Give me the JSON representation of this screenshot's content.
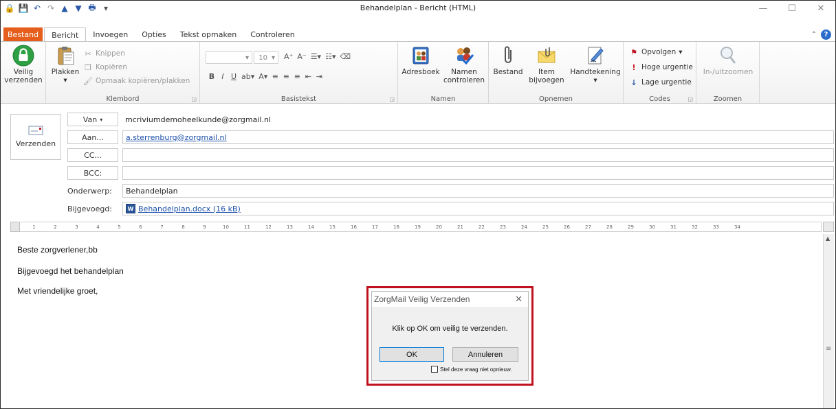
{
  "window": {
    "title": "Behandelplan - Bericht (HTML)"
  },
  "tabs": [
    {
      "label": "Bestand"
    },
    {
      "label": "Bericht"
    },
    {
      "label": "Invoegen"
    },
    {
      "label": "Opties"
    },
    {
      "label": "Tekst opmaken"
    },
    {
      "label": "Controleren"
    }
  ],
  "ribbon": {
    "secure_send": {
      "line1": "Veilig",
      "line2": "verzenden"
    },
    "clipboard": {
      "label": "Klembord",
      "paste": "Plakken",
      "cut": "Knippen",
      "copy": "Kopiëren",
      "format_painter": "Opmaak kopiëren/plakken"
    },
    "basic_text": {
      "label": "Basistekst",
      "font_size": "10"
    },
    "names": {
      "label": "Namen",
      "address_book": "Adresboek",
      "check_names_1": "Namen",
      "check_names_2": "controleren"
    },
    "include": {
      "label": "Opnemen",
      "file": "Bestand",
      "item_1": "Item",
      "item_2": "bijvoegen",
      "signature": "Handtekening"
    },
    "tags": {
      "label": "Codes",
      "follow_up": "Opvolgen",
      "high": "Hoge urgentie",
      "low": "Lage urgentie"
    },
    "zoom": {
      "label": "Zoomen",
      "zoom": "In-/uitzoomen"
    }
  },
  "header": {
    "send": "Verzenden",
    "from_btn": "Van",
    "from_value": "mcriviumdemoheelkunde@zorgmail.nl",
    "to_btn": "Aan...",
    "to_value": "a.sterrenburg@zorgmail.nl",
    "cc_btn": "CC...",
    "bcc_btn": "BCC:",
    "subject_label": "Onderwerp:",
    "subject_value": "Behandelplan",
    "attach_label": "Bijgevoegd:",
    "attach_value": "Behandelplan.docx (16 kB)"
  },
  "body": {
    "line1": "Beste zorgverlener,bb",
    "line2": "Bijgevoegd het behandelplan",
    "line3": "Met vriendelijke groet,"
  },
  "dialog": {
    "title": "ZorgMail Veilig Verzenden",
    "message": "Klik op OK om veilig te verzenden.",
    "ok": "OK",
    "cancel": "Annuleren",
    "checkbox": "Stel deze vraag niet opnieuw."
  }
}
